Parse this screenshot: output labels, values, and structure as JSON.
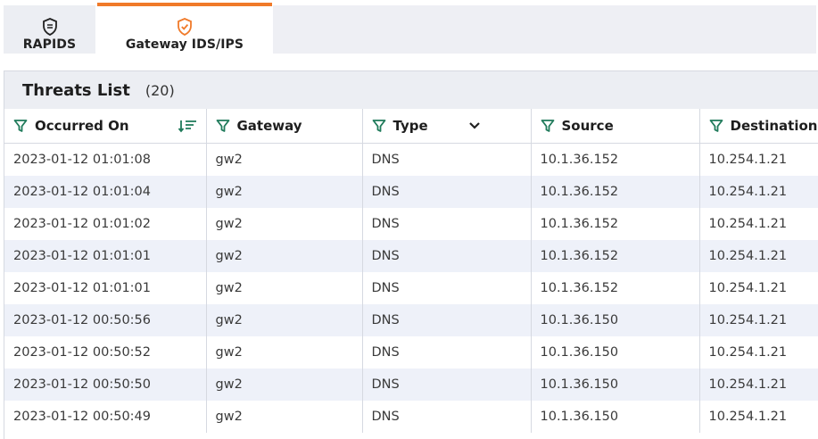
{
  "tabs": [
    {
      "label": "RAPIDS",
      "icon": "shield-icon",
      "active": false
    },
    {
      "label": "Gateway IDS/IPS",
      "icon": "shield-check-icon",
      "active": true
    }
  ],
  "colors": {
    "accent": "#f07a2a",
    "alt_row": "#eef1f9",
    "header_bg": "#eceef3"
  },
  "threats_panel": {
    "title": "Threats List",
    "count": "(20)",
    "columns": [
      {
        "label": "Occurred On",
        "filter_icon": "filter-icon",
        "extra_icon": "sort-desc-icon"
      },
      {
        "label": "Gateway",
        "filter_icon": "filter-icon"
      },
      {
        "label": "Type",
        "filter_icon": "filter-icon",
        "extra_icon": "chevron-down-icon"
      },
      {
        "label": "Source",
        "filter_icon": "filter-icon"
      },
      {
        "label": "Destination",
        "filter_icon": "filter-icon"
      }
    ],
    "rows": [
      [
        "2023-01-12 01:01:08",
        "gw2",
        "DNS",
        "10.1.36.152",
        "10.254.1.21"
      ],
      [
        "2023-01-12 01:01:04",
        "gw2",
        "DNS",
        "10.1.36.152",
        "10.254.1.21"
      ],
      [
        "2023-01-12 01:01:02",
        "gw2",
        "DNS",
        "10.1.36.152",
        "10.254.1.21"
      ],
      [
        "2023-01-12 01:01:01",
        "gw2",
        "DNS",
        "10.1.36.152",
        "10.254.1.21"
      ],
      [
        "2023-01-12 01:01:01",
        "gw2",
        "DNS",
        "10.1.36.152",
        "10.254.1.21"
      ],
      [
        "2023-01-12 00:50:56",
        "gw2",
        "DNS",
        "10.1.36.150",
        "10.254.1.21"
      ],
      [
        "2023-01-12 00:50:52",
        "gw2",
        "DNS",
        "10.1.36.150",
        "10.254.1.21"
      ],
      [
        "2023-01-12 00:50:50",
        "gw2",
        "DNS",
        "10.1.36.150",
        "10.254.1.21"
      ],
      [
        "2023-01-12 00:50:49",
        "gw2",
        "DNS",
        "10.1.36.150",
        "10.254.1.21"
      ]
    ]
  }
}
